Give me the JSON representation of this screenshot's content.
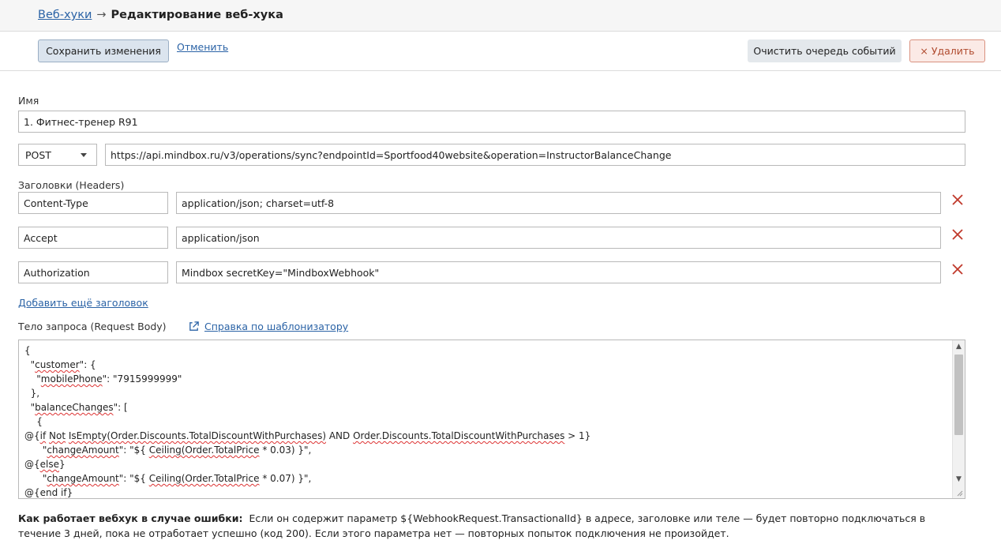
{
  "breadcrumb": {
    "parent": "Веб-хуки",
    "arrow": "→",
    "current": "Редактирование веб-хука"
  },
  "toolbar": {
    "save_label": "Сохранить изменения",
    "cancel_label": "Отменить",
    "clear_queue_label": "Очистить очередь событий",
    "delete_label": "× Удалить"
  },
  "form": {
    "name_label": "Имя",
    "name_value": "1. Фитнес-тренер R91",
    "method_value": "POST",
    "url_value": "https://api.mindbox.ru/v3/operations/sync?endpointId=Sportfood40website&operation=InstructorBalanceChange",
    "headers_label": "Заголовки (Headers)",
    "headers": [
      {
        "key": "Content-Type",
        "value": "application/json; charset=utf-8"
      },
      {
        "key": "Accept",
        "value": "application/json"
      },
      {
        "key": "Authorization",
        "value": "Mindbox secretKey=\"MindboxWebhook\""
      }
    ],
    "add_header_label": "Добавить ещё заголовок",
    "body_label": "Тело запроса (Request Body)",
    "help_link_label": "Справка по шаблонизатору"
  },
  "body_code": {
    "l1": "{",
    "l2a": "  \"",
    "l2b": "customer",
    "l2c": "\": {",
    "l3a": "    \"",
    "l3b": "mobilePhone",
    "l3c": "\": \"7915999999\"",
    "l4": "  },",
    "l5a": "  \"",
    "l5b": "balanceChanges",
    "l5c": "\": [",
    "l6": "    {",
    "l7a": "@{",
    "l7b": "if",
    "l7c": " ",
    "l7d": "Not",
    "l7e": " ",
    "l7f": "IsEmpty(Order.Discounts.TotalDiscountWithPurchases)",
    "l7g": " AND ",
    "l7h": "Order.Discounts.TotalDiscountWithPurchases",
    "l7i": " > 1}",
    "l8a": "      \"",
    "l8b": "changeAmount",
    "l8c": "\": \"${ ",
    "l8d": "Ceiling(Order.TotalPrice",
    "l8e": " * 0.03) }\",",
    "l9a": "@{",
    "l9b": "else",
    "l9c": "}",
    "l10a": "      \"",
    "l10b": "changeAmount",
    "l10c": "\": \"${ ",
    "l10d": "Ceiling(Order.TotalPrice",
    "l10e": " * 0.07) }\",",
    "l11a": "@{",
    "l11b": "end if",
    "l11c": "}"
  },
  "note": {
    "title": "Как работает вебхук в случае ошибки:",
    "text": "Если он содержит параметр ${WebhookRequest.TransactionalId} в адресе, заголовке или теле — будет повторно подключаться в течение 3 дней, пока не отработает успешно (код 200). Если этого параметра нет — повторных попыток подключения не произойдет."
  },
  "colors": {
    "link": "#2b63a6",
    "delete_x": "#c0392b",
    "save_bg": "#dbe4ee",
    "delete_bg": "#fbeae6"
  },
  "icons": {
    "remove": "close-x-icon",
    "external": "external-link-icon",
    "dropdown": "chevron-down-icon"
  }
}
